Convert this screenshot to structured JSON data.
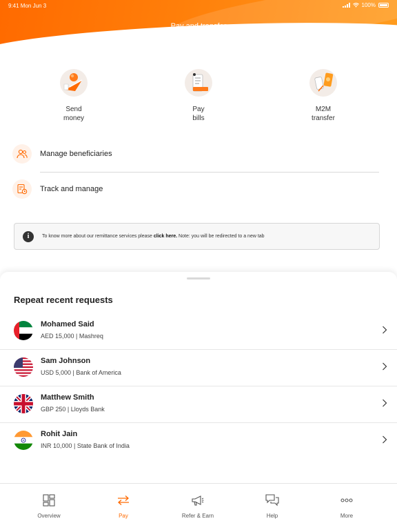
{
  "status_bar": {
    "time": "9:41  Mon Jun 3",
    "battery": "100%"
  },
  "header": {
    "title": "Pay and transfer"
  },
  "actions": [
    {
      "label": "Send\nmoney",
      "icon": "send-money-icon"
    },
    {
      "label": "Pay\nbills",
      "icon": "pay-bills-icon"
    },
    {
      "label": "M2M\ntransfer",
      "icon": "m2m-transfer-icon"
    }
  ],
  "options": [
    {
      "label": "Manage beneficiaries",
      "icon": "beneficiaries-icon"
    },
    {
      "label": "Track and manage",
      "icon": "track-manage-icon"
    }
  ],
  "info_banner": {
    "text_before": "To know more about our remittance services please ",
    "link": "click here.",
    "text_after": " Note: you will be redirected to a new tab"
  },
  "recent": {
    "title": "Repeat recent requests",
    "items": [
      {
        "name": "Mohamed Said",
        "detail": "AED 15,000 | Mashreq",
        "flag": "uae-flag-icon"
      },
      {
        "name": "Sam Johnson",
        "detail": "USD 5,000 | Bank of America",
        "flag": "usa-flag-icon"
      },
      {
        "name": "Matthew Smith",
        "detail": "GBP 250 | Lloyds Bank",
        "flag": "uk-flag-icon"
      },
      {
        "name": "Rohit Jain",
        "detail": "INR 10,000 | State Bank of India",
        "flag": "india-flag-icon"
      }
    ]
  },
  "nav": {
    "tabs": [
      {
        "label": "Overview",
        "icon": "overview-icon"
      },
      {
        "label": "Pay",
        "icon": "pay-transfer-icon",
        "active": true
      },
      {
        "label": "Refer & Earn",
        "icon": "megaphone-icon"
      },
      {
        "label": "Help",
        "icon": "chat-help-icon"
      },
      {
        "label": "More",
        "icon": "more-dots-icon"
      }
    ]
  },
  "colors": {
    "accent": "#ff6a00",
    "accent_light": "#fff1e8"
  }
}
